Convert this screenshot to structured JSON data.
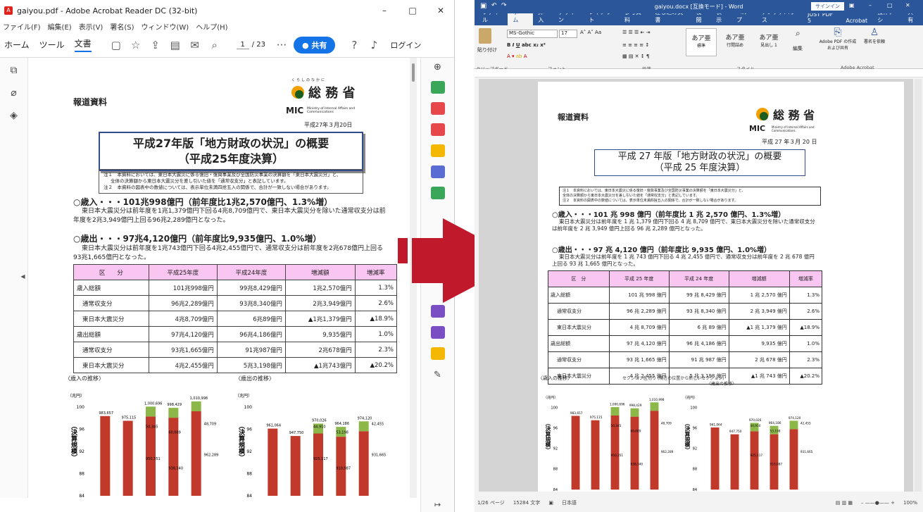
{
  "acrobat": {
    "title": "gaiyou.pdf - Adobe Acrobat Reader DC (32-bit)",
    "menu": [
      "ファイル(F)",
      "編集(E)",
      "表示(V)",
      "署名(S)",
      "ウィンドウ(W)",
      "ヘルプ(H)"
    ],
    "tabs": [
      "ホーム",
      "ツール",
      "文書"
    ],
    "page_current": "1",
    "page_total": "/ 23",
    "share_label": "共有",
    "login_label": "ログイン"
  },
  "doc": {
    "label": "報道資料",
    "org_name": "総 務 省",
    "org_kana": "くらしのなかに",
    "mic": "MIC",
    "mic_sub": "Ministry of Internal Affairs and Communications",
    "date": "平成27年３月20日",
    "title1": "平成27年版「地方財政の状況」の概要",
    "title2": "（平成25年度決算）",
    "note1": "注１　本資料においては、東日本大震災に係る復旧・復興事業及び全国防災事業の決算額を「東日本大震災分」と、",
    "note1b": "全体の決算額から東日本大震災分を差し引いた値を「通常収支分」と表記しています。",
    "note2": "注２　本資料の図表中の数値については、表示単位未満四捨五入の関係で、合計が一致しない場合があります。",
    "rev_head": "○歳入・・・101兆998億円（前年度比1兆2,570億円、1.3%増）",
    "rev_body": "東日本大震災分は前年度を1兆1,379億円下回る4兆8,709億円で、東日本大震災分を除いた通常収支分は前年度を2兆3,949億円上回る96兆2,289億円となった。",
    "exp_head": "○歳出・・・97兆4,120億円（前年度比9,935億円、1.0%増）",
    "exp_body": "東日本大震災分は前年度を1兆743億円下回る4兆2,455億円で、通常収支分は前年度を2兆678億円上回る93兆1,665億円となった。",
    "table_header": [
      "区　　分",
      "平成25年度",
      "平成24年度",
      "増減額",
      "増減率"
    ],
    "table_rows": [
      [
        "歳入総額",
        "101兆998億円",
        "99兆8,429億円",
        "1兆2,570億円",
        "1.3%"
      ],
      [
        "通常収支分",
        "96兆2,289億円",
        "93兆8,340億円",
        "2兆3,949億円",
        "2.6%"
      ],
      [
        "東日本大震災分",
        "4兆8,709億円",
        "6兆89億円",
        "▲1兆1,379億円",
        "▲18.9%"
      ],
      [
        "歳出総額",
        "97兆4,120億円",
        "96兆4,186億円",
        "9,935億円",
        "1.0%"
      ],
      [
        "通常収支分",
        "93兆1,665億円",
        "91兆987億円",
        "2兆678億円",
        "2.3%"
      ],
      [
        "東日本大震災分",
        "4兆2,455億円",
        "5兆3,198億円",
        "▲1兆743億円",
        "▲20.2%"
      ]
    ],
    "chart_rev_title": "〈歳入の推移〉",
    "chart_exp_title": "〈歳出の推移〉",
    "chart_unit": "（兆円）",
    "chart_ylabel": "（決算規模）"
  },
  "chart_data": [
    {
      "type": "bar",
      "title": "〈歳入の推移〉",
      "ylabel": "（兆円）",
      "ylim": [
        84,
        101
      ],
      "yticks": [
        84,
        88,
        92,
        96,
        100
      ],
      "totals": [
        983657,
        975115,
        1000696,
        998429,
        1010998
      ],
      "labels_extra": [
        "50,345",
        "60,089",
        "48,709",
        "950,351",
        "938,340",
        "962,289"
      ]
    },
    {
      "type": "bar",
      "title": "〈歳出の推移〉",
      "ylabel": "（兆円）",
      "ylim": [
        84,
        101
      ],
      "yticks": [
        84,
        88,
        92,
        96,
        100
      ],
      "totals": [
        961064,
        947750,
        970026,
        964186,
        974120
      ],
      "labels_extra": [
        "44,910",
        "53,198",
        "42,455",
        "925,117",
        "910,987",
        "931,665"
      ]
    }
  ],
  "word": {
    "title": "gaiyou.docx [互換モード] - Word",
    "signin": "サインイン",
    "tabs": [
      "ファイル",
      "ホーム",
      "挿入",
      "デザイン",
      "レイアウト",
      "参考資料",
      "差し込み文書",
      "校閲",
      "表示",
      "ヘルプ",
      "アンテナハウス",
      "JUST PDF 5",
      "Acrobat",
      "操作アシ",
      "共有"
    ],
    "font_name": "MS-Gothic",
    "font_size": "17",
    "groups": [
      "クリップボード",
      "フォント",
      "段落",
      "スタイル",
      "Adobe Acrobat"
    ],
    "styles": [
      "あア亜",
      "あア亜",
      "あア亜"
    ],
    "style_names": [
      "標準",
      "行間詰め",
      "見出し 1"
    ],
    "paste": "貼り付け",
    "edit": "編集",
    "adobe_pdf": "Adobe PDF の作成および共有",
    "sign": "署名を依頼",
    "status_page": "1/26 ページ",
    "status_words": "15284 文字",
    "status_lang": "日本語",
    "zoom": "100%",
    "section_break": "セクション区切り (現在の位置から新しいセクション)",
    "w_title1": "平成 27 年版「地方財政の状況」の概要",
    "w_title2": "（平成 25 年度決算）",
    "w_rev_head": "○歳入・・・101 兆 998 億円（前年度比 1 兆 2,570 億円、1.3%増）",
    "w_rev_body": "東日本大震災分は前年度を 1 兆 1,379 億円下回る 4 兆 8,709 億円で、東日本大震災分を除いた通常収支分は前年度を 2 兆 3,949 億円上回る 96 兆 2,289 億円となった。",
    "w_exp_head": "○歳出・・・97 兆 4,120 億円（前年度比 9,935 億円、1.0%増）",
    "w_exp_body": "東日本大震災分は前年度を 1 兆 743 億円下回る 4 兆 2,455 億円で、通常収支分は前年度を 2 兆 678 億円上回る 93 兆 1,665 億円となった。",
    "w_date": "平成 27 年３月 20 日",
    "w_table_header": [
      "区　分",
      "平成 25 年度",
      "平成 24 年度",
      "増減額",
      "増減率"
    ],
    "w_table_rows": [
      [
        "歳入総額",
        "101 兆 998 億円",
        "99 兆 8,429 億円",
        "1 兆 2,570 億円",
        "1.3%"
      ],
      [
        "通常収支分",
        "96 兆 2,289 億円",
        "93 兆 8,340 億円",
        "2 兆 3,949 億円",
        "2.6%"
      ],
      [
        "東日本大震災分",
        "4 兆 8,709 億円",
        "6 兆 89 億円",
        "▲1 兆 1,379 億円",
        "▲18.9%"
      ],
      [
        "歳出総額",
        "97 兆 4,120 億円",
        "96 兆 4,186 億円",
        "9,935 億円",
        "1.0%"
      ],
      [
        "通常収支分",
        "93 兆 1,665 億円",
        "91 兆 987 億円",
        "2 兆 678 億円",
        "2.3%"
      ],
      [
        "東日本大震災分",
        "4 兆 2,455 億円",
        "5 兆 3,198 億円",
        "▲1 兆 743 億円",
        "▲20.2%"
      ]
    ],
    "w_chart_head": "〈歳入の推移〉",
    "w_chart_head2": "〈歳出の推移〉"
  },
  "colors": {
    "word_blue": "#2b579a",
    "acrobat_blue": "#1473e6",
    "bar_red": "#c0392b",
    "bar_green": "#8cb84a",
    "arrow_red": "#c0192b"
  }
}
